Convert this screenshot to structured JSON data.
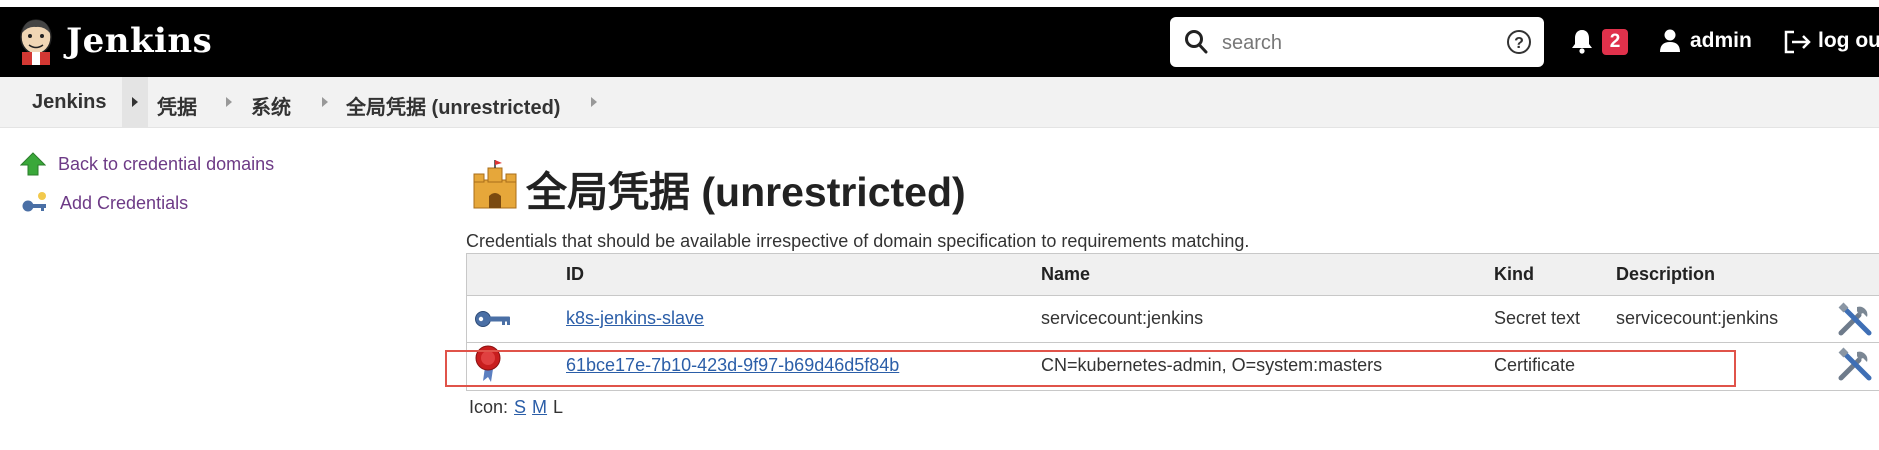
{
  "header": {
    "brand": "Jenkins",
    "search_placeholder": "search",
    "notifications_count": "2",
    "username": "admin",
    "logout_label": "log ou"
  },
  "breadcrumb": [
    "Jenkins",
    "凭据",
    "系统",
    "全局凭据 (unrestricted)"
  ],
  "sidebar": {
    "back_label": "Back to credential domains",
    "add_label": "Add Credentials"
  },
  "main": {
    "title": "全局凭据 (unrestricted)",
    "description": "Credentials that should be available irrespective of domain specification to requirements matching.",
    "columns": {
      "id": "ID",
      "name": "Name",
      "kind": "Kind",
      "description": "Description"
    },
    "rows": [
      {
        "id": "k8s-jenkins-slave",
        "name": "servicecount:jenkins",
        "kind": "Secret text",
        "description": "servicecount:jenkins",
        "icon": "key-icon"
      },
      {
        "id": "61bce17e-7b10-423d-9f97-b69d46d5f84b",
        "name": "CN=kubernetes-admin, O=system:masters",
        "kind": "Certificate",
        "description": "",
        "icon": "certificate-icon"
      }
    ],
    "icon_size": {
      "label": "Icon:",
      "small": "S",
      "medium": "M",
      "large": "L"
    }
  }
}
